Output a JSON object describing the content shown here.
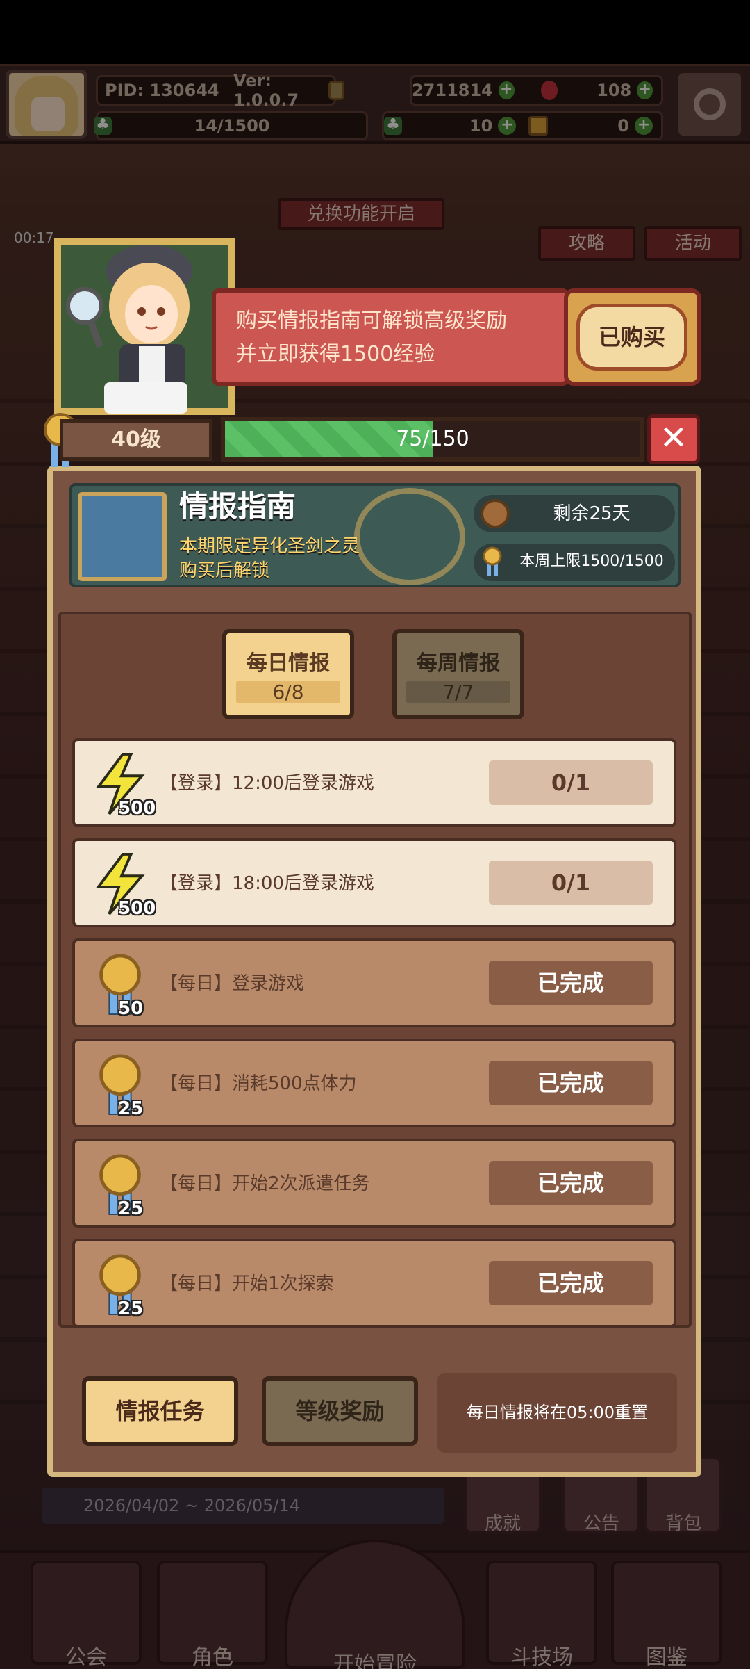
{
  "topbar": {
    "pid": "PID: 130644",
    "version": "Ver: 1.0.0.7",
    "gold": "2711814",
    "gems": "108",
    "level_progress": "14/1500",
    "clover": "10",
    "keys": "0"
  },
  "background": {
    "title_partial": "兑换功能开启",
    "timer": "00:17",
    "gonglue": "攻略",
    "huodong": "活动",
    "date_range": "2026/04/02 ~ 2026/05/14",
    "side_buttons": [
      "成就",
      "公告",
      "背包"
    ],
    "nav": [
      "公会",
      "角色",
      "开始冒险",
      "斗技场",
      "图鉴"
    ]
  },
  "banner": {
    "line1": "购买情报指南可解锁高级奖励",
    "line2": "并立即获得1500经验",
    "buy_label": "已购买"
  },
  "level": {
    "label": "40级",
    "xp_text": "75/150",
    "xp_fraction": 0.5
  },
  "guide": {
    "title": "情报指南",
    "subtitle1": "本期限定异化圣剑之灵",
    "subtitle2": "购买后解锁",
    "remaining": "剩余25天",
    "weekly_cap": "本周上限1500/1500"
  },
  "tabs": {
    "daily": {
      "label": "每日情报",
      "count": "6/8"
    },
    "weekly": {
      "label": "每周情报",
      "count": "7/7"
    }
  },
  "tasks": [
    {
      "desc": "【登录】12:00后登录游戏",
      "reward": "500",
      "status": "0/1",
      "icon": "lightning-icon",
      "done": false
    },
    {
      "desc": "【登录】18:00后登录游戏",
      "reward": "500",
      "status": "0/1",
      "icon": "lightning-icon",
      "done": false
    },
    {
      "desc": "【每日】登录游戏",
      "reward": "50",
      "status": "已完成",
      "icon": "medal-icon",
      "done": true
    },
    {
      "desc": "【每日】消耗500点体力",
      "reward": "25",
      "status": "已完成",
      "icon": "medal-icon",
      "done": true
    },
    {
      "desc": "【每日】开始2次派遣任务",
      "reward": "25",
      "status": "已完成",
      "icon": "medal-icon",
      "done": true
    },
    {
      "desc": "【每日】开始1次探索",
      "reward": "25",
      "status": "已完成",
      "icon": "medal-icon",
      "done": true
    }
  ],
  "bottom": {
    "task_tab": "情报任务",
    "reward_tab": "等级奖励",
    "reset_note": "每日情报将在05:00重置"
  },
  "colors": {
    "accent_gold": "#f2d28e",
    "xp_green": "#4fb05a",
    "banner_red": "#cc5651",
    "panel_brown": "#7a5242"
  }
}
